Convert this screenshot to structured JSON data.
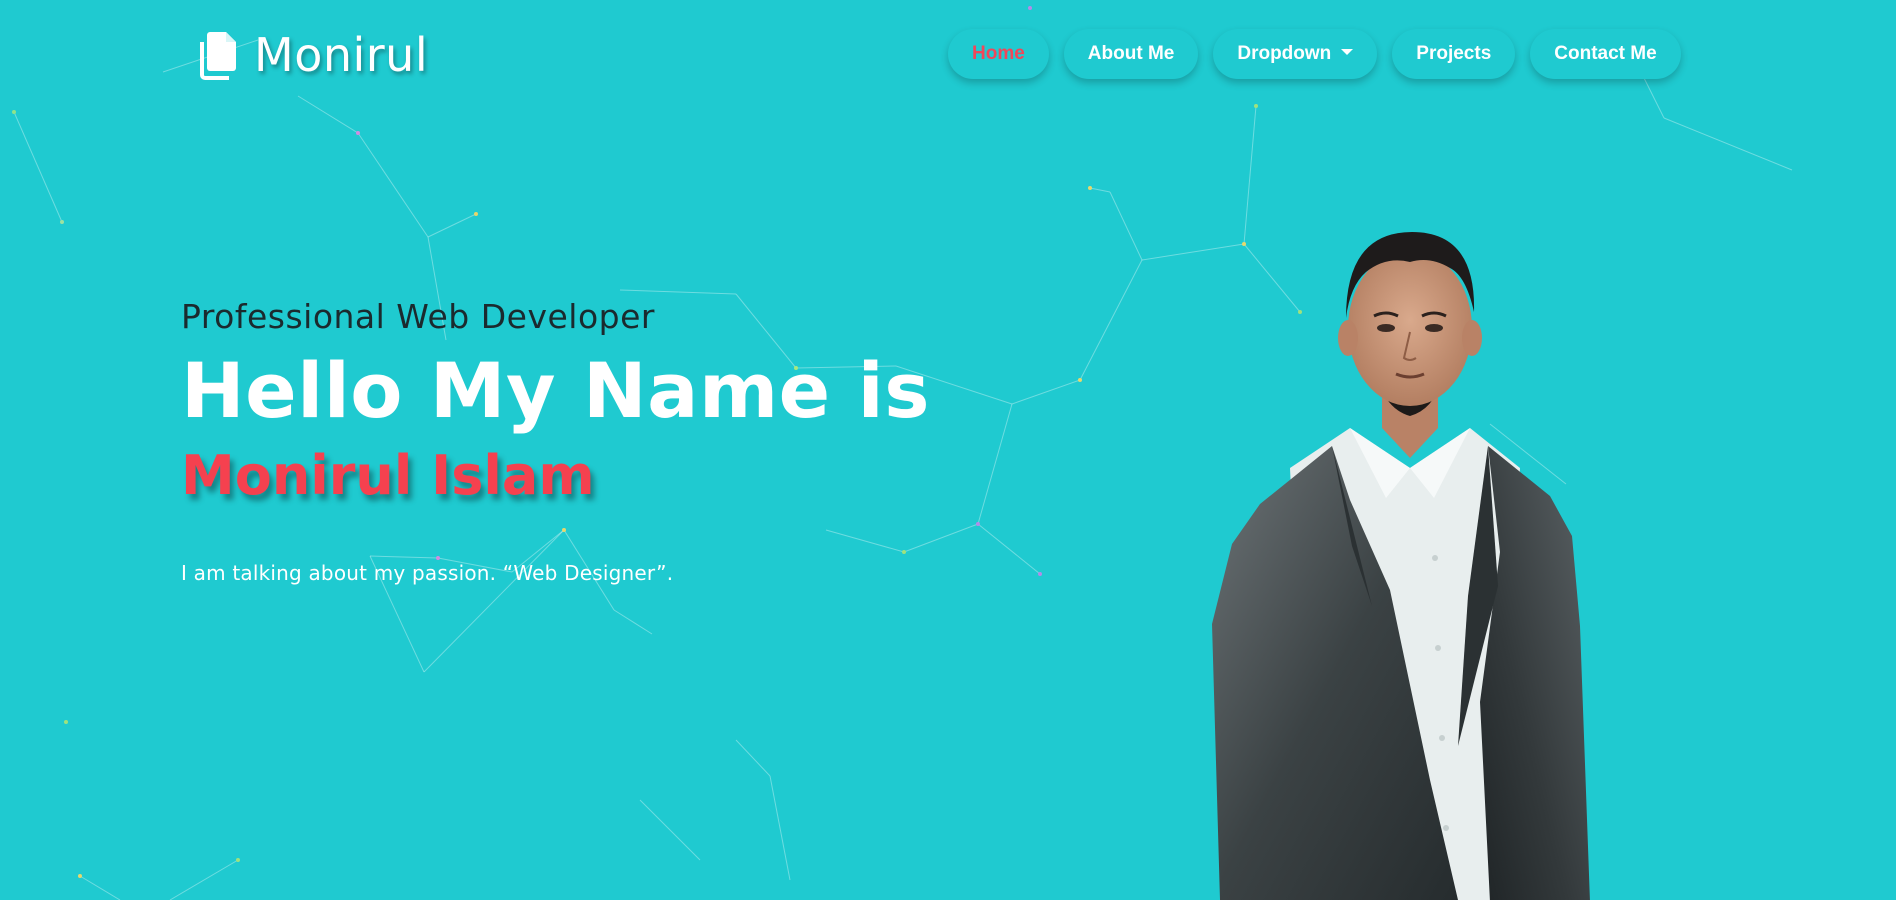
{
  "brand": {
    "name": "Monirul",
    "icon": "files-icon"
  },
  "nav": {
    "items": [
      {
        "label": "Home",
        "active": true
      },
      {
        "label": "About Me",
        "active": false
      },
      {
        "label": "Dropdown",
        "active": false,
        "has_caret": true
      },
      {
        "label": "Projects",
        "active": false
      },
      {
        "label": "Contact Me",
        "active": false
      }
    ]
  },
  "hero": {
    "subtitle": "Professional Web Developer",
    "headline": "Hello My Name is",
    "name": "Monirul Islam",
    "tagline": "I am talking about my passion. “Web Designer”."
  },
  "portrait": {
    "description_icon": "person-portrait"
  },
  "colors": {
    "background": "#1fcad0",
    "accent_red": "#f5414f",
    "active_nav": "#f0475a",
    "text_dark": "#1b2a2e",
    "text_light": "#ffffff"
  }
}
